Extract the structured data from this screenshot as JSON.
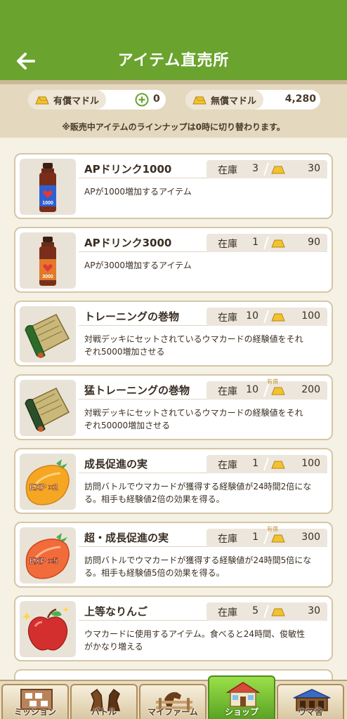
{
  "header": {
    "title": "アイテム直売所"
  },
  "currency": {
    "paid": {
      "label": "有償マドル",
      "value": "0"
    },
    "free": {
      "label": "無償マドル",
      "value": "4,280"
    },
    "notice": "※販売中アイテムのラインナップは0時に切り替わります。"
  },
  "shop": {
    "stock_label": "在庫",
    "items": [
      {
        "name": "APドリンク1000",
        "stock": "3",
        "price": "30",
        "desc_1": "APが1000増加するアイテム",
        "desc_2": "",
        "icon": "ap-drink-1000-icon",
        "bottle_label": "1000"
      },
      {
        "name": "APドリンク3000",
        "stock": "1",
        "price": "90",
        "desc_1": "APが3000増加するアイテム",
        "desc_2": "",
        "icon": "ap-drink-3000-icon",
        "bottle_label": "3000"
      },
      {
        "name": "トレーニングの巻物",
        "stock": "10",
        "price": "100",
        "desc_1": "対戦デッキにセットされているウマカードの経験値をそれ",
        "desc_2": "ぞれ5000増加させる",
        "icon": "training-scroll-icon"
      },
      {
        "name": "猛トレーニングの巻物",
        "stock": "10",
        "price": "200",
        "paid_tag": "有償",
        "desc_1": "対戦デッキにセットされているウマカードの経験値をそれ",
        "desc_2": "ぞれ50000増加させる",
        "icon": "intense-training-scroll-icon"
      },
      {
        "name": "成長促進の実",
        "stock": "1",
        "price": "100",
        "desc_1": "訪問バトルでウマカードが獲得する経験値が24時間2倍にな",
        "desc_2": "る。相手も経験値2倍の効果を得る。",
        "icon": "growth-fruit-x2-icon",
        "fruit_label": "EXP ×2"
      },
      {
        "name": "超・成長促進の実",
        "stock": "1",
        "price": "300",
        "paid_tag": "有償",
        "desc_1": "訪問バトルでウマカードが獲得する経験値が24時間5倍にな",
        "desc_2": "る。相手も経験値5倍の効果を得る。",
        "icon": "growth-fruit-x5-icon",
        "fruit_label": "EXP ×5"
      },
      {
        "name": "上等なりんご",
        "stock": "5",
        "price": "30",
        "desc_1": "ウマカードに使用するアイテム。食べると24時間、俊敏性",
        "desc_2": "がかなり増える",
        "icon": "apple-icon"
      }
    ]
  },
  "nav": {
    "items": [
      {
        "label": "ミッション",
        "icon": "mission-board-icon"
      },
      {
        "label": "バトル",
        "icon": "battle-horses-icon"
      },
      {
        "label": "マイファーム",
        "icon": "farm-fence-icon"
      },
      {
        "label": "ショップ",
        "icon": "shop-house-icon",
        "active": true
      },
      {
        "label": "ウマ舎",
        "icon": "stable-icon"
      }
    ]
  },
  "colors": {
    "header": "#6aa32e",
    "accent_gold": "#e3b52a",
    "nav_active": "#6cbb2a"
  }
}
